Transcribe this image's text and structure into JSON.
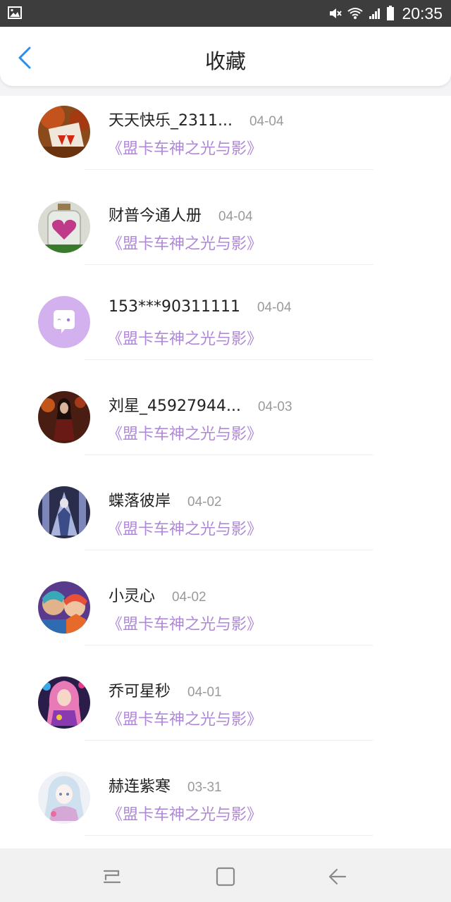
{
  "status_bar": {
    "time": "20:35",
    "icons": [
      "gallery-icon",
      "mute-icon",
      "wifi-icon",
      "signal-icon",
      "battery-icon"
    ]
  },
  "header": {
    "title": "收藏",
    "back_icon": "chevron-left-icon",
    "accent_color": "#2b8ff0"
  },
  "favorites": [
    {
      "name": "天天快乐_2311...",
      "date": "04-04",
      "book": "《盟卡车神之光与影》"
    },
    {
      "name": "财普今通人册",
      "date": "04-04",
      "book": "《盟卡车神之光与影》"
    },
    {
      "name": "153***90311111",
      "date": "04-04",
      "book": "《盟卡车神之光与影》"
    },
    {
      "name": "刘星_45927944...",
      "date": "04-03",
      "book": "《盟卡车神之光与影》"
    },
    {
      "name": "蝶落彼岸",
      "date": "04-02",
      "book": "《盟卡车神之光与影》"
    },
    {
      "name": "小灵心",
      "date": "04-02",
      "book": "《盟卡车神之光与影》"
    },
    {
      "name": "乔可星秒",
      "date": "04-01",
      "book": "《盟卡车神之光与影》"
    },
    {
      "name": "赫连紫寒",
      "date": "03-31",
      "book": "《盟卡车神之光与影》"
    }
  ],
  "colors": {
    "book_title": "#b088d8",
    "name": "#222222",
    "date": "#9a9a9a",
    "status_bar": "#3d3d3d"
  },
  "nav_bar": {
    "icons": [
      "recent-apps-icon",
      "home-icon",
      "back-icon"
    ]
  }
}
